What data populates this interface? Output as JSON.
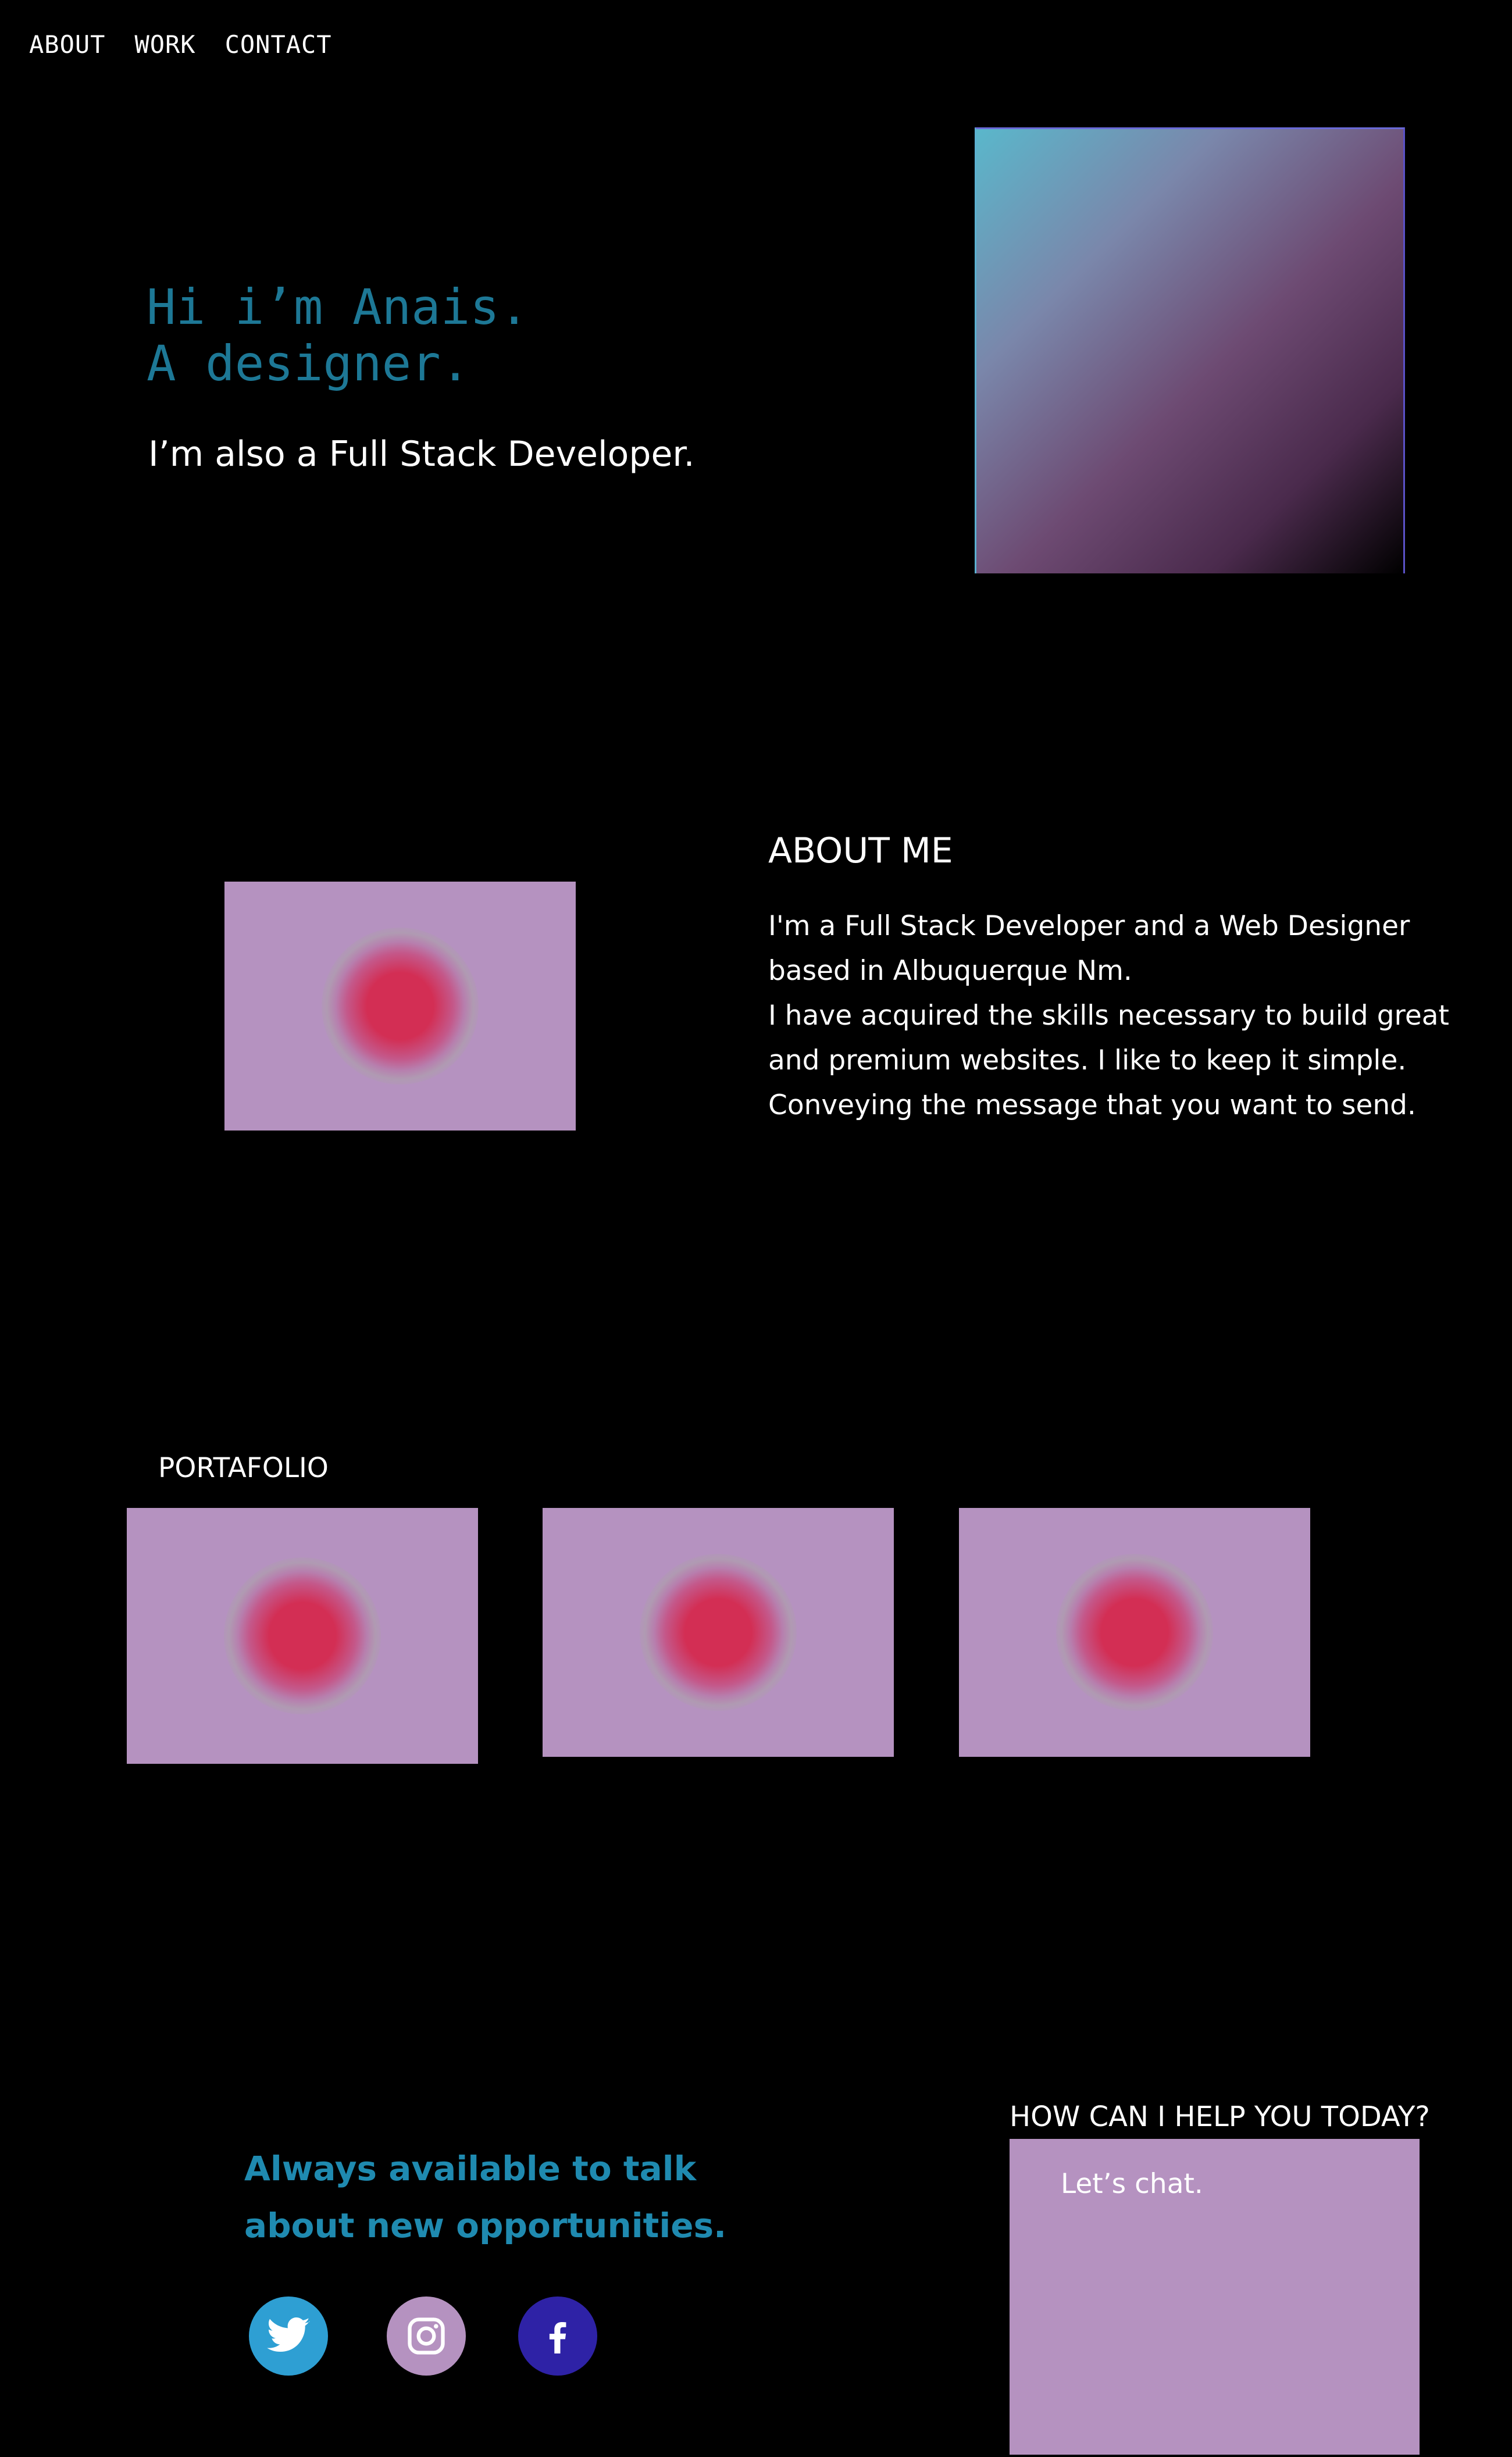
{
  "nav": {
    "items": [
      {
        "label": "ABOUT"
      },
      {
        "label": "WORK"
      },
      {
        "label": "CONTACT"
      }
    ]
  },
  "hero": {
    "line1": "Hi i’m Anais.",
    "line2": "A designer.",
    "subtitle": "I’m also a Full Stack Developer."
  },
  "about": {
    "title": "ABOUT ME",
    "lines": [
      "I'm a Full Stack Developer and a Web Designer",
      "based in Albuquerque Nm.",
      "I have acquired the skills necessary to build great",
      "and premium websites. I like to keep it simple.",
      "Conveying the message that you want to send."
    ]
  },
  "portfolio": {
    "title": "PORTAFOLIO"
  },
  "contact": {
    "cta_line1": "Always available to talk",
    "cta_line2": "about new opportunities.",
    "help_title": "HOW CAN I HELP YOU TODAY?",
    "chat_placeholder": "Let’s chat."
  },
  "colors": {
    "background": "#000000",
    "accent_teal": "#1d7896",
    "cta_blue": "#1f8ab0",
    "card_lilac": "#b592c0",
    "blob_red": "#d32e54",
    "twitter": "#2e9fd3",
    "instagram": "#b592c0",
    "facebook": "#2e22a6"
  },
  "icons": [
    "twitter-icon",
    "instagram-icon",
    "facebook-icon"
  ]
}
